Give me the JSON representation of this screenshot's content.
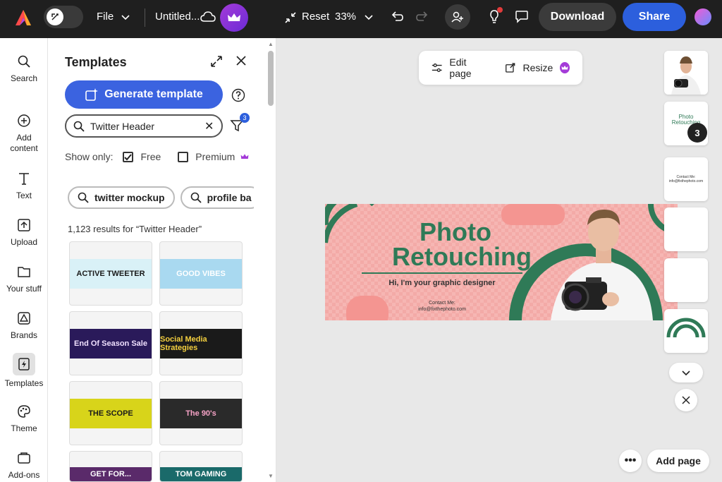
{
  "topbar": {
    "file_label": "File",
    "doc_title": "Untitled...",
    "reset_label": "Reset",
    "zoom": "33%",
    "download_label": "Download",
    "share_label": "Share"
  },
  "rail": {
    "items": [
      {
        "label": "Search",
        "icon": "search-icon"
      },
      {
        "label": "Add content",
        "icon": "plus-circle-icon"
      },
      {
        "label": "Text",
        "icon": "text-icon"
      },
      {
        "label": "Upload",
        "icon": "upload-icon"
      },
      {
        "label": "Your stuff",
        "icon": "folder-icon"
      },
      {
        "label": "Brands",
        "icon": "brand-icon"
      },
      {
        "label": "Templates",
        "icon": "templates-icon",
        "active": true
      },
      {
        "label": "Theme",
        "icon": "palette-icon"
      },
      {
        "label": "Add-ons",
        "icon": "addons-icon"
      }
    ]
  },
  "panel": {
    "title": "Templates",
    "generate_label": "Generate template",
    "search_value": "Twitter Header",
    "filter_count": "3",
    "show_only_label": "Show only:",
    "free_label": "Free",
    "premium_label": "Premium",
    "chips": [
      "twitter mockup",
      "profile ba"
    ],
    "results_text": "1,123 results for “Twitter Header”",
    "templates": [
      {
        "text": "ACTIVE TWEETER",
        "bg": "#d9f1f7",
        "fg": "#1a1a1a"
      },
      {
        "text": "GOOD VIBES",
        "bg": "#a9d9f0",
        "fg": "#ffffff"
      },
      {
        "text": "End Of Season Sale",
        "bg": "#2a1a5a",
        "fg": "#f0e0ff"
      },
      {
        "text": "Social Media Strategies",
        "bg": "#1a1a1a",
        "fg": "#f4d03f"
      },
      {
        "text": "THE SCOPE",
        "bg": "#d8d41a",
        "fg": "#1a1a1a"
      },
      {
        "text": "The 90's",
        "bg": "#2a2a2a",
        "fg": "#f7a3c7"
      },
      {
        "text": "GET FOR...",
        "bg": "#5a2a6a",
        "fg": "#ffffff"
      },
      {
        "text": "TOM GAMING",
        "bg": "#1a6a6a",
        "fg": "#ffffff"
      }
    ]
  },
  "canvas": {
    "edit_page_label": "Edit page",
    "resize_label": "Resize",
    "design": {
      "headline": "Photo Retouching",
      "subline": "Hi, I'm your graphic designer",
      "contact_label": "Contact Me:",
      "contact_email": "info@fixthephoto.com"
    },
    "pages": [
      {
        "kind": "photo"
      },
      {
        "kind": "text",
        "text": "Photo Retouching",
        "count": "3"
      },
      {
        "kind": "contact",
        "text": "Contact Me: info@fixthephoto.com"
      },
      {
        "kind": "blank"
      },
      {
        "kind": "blank"
      },
      {
        "kind": "arc"
      }
    ],
    "add_page_label": "Add page"
  },
  "colors": {
    "topbar_bg": "#1f1f1f",
    "share_blue": "#2c5fdd",
    "generate_blue": "#3b63e0",
    "design_pink": "#f6b6b3",
    "design_green": "#2f7a57",
    "premium_purple": "#a43bd8"
  }
}
